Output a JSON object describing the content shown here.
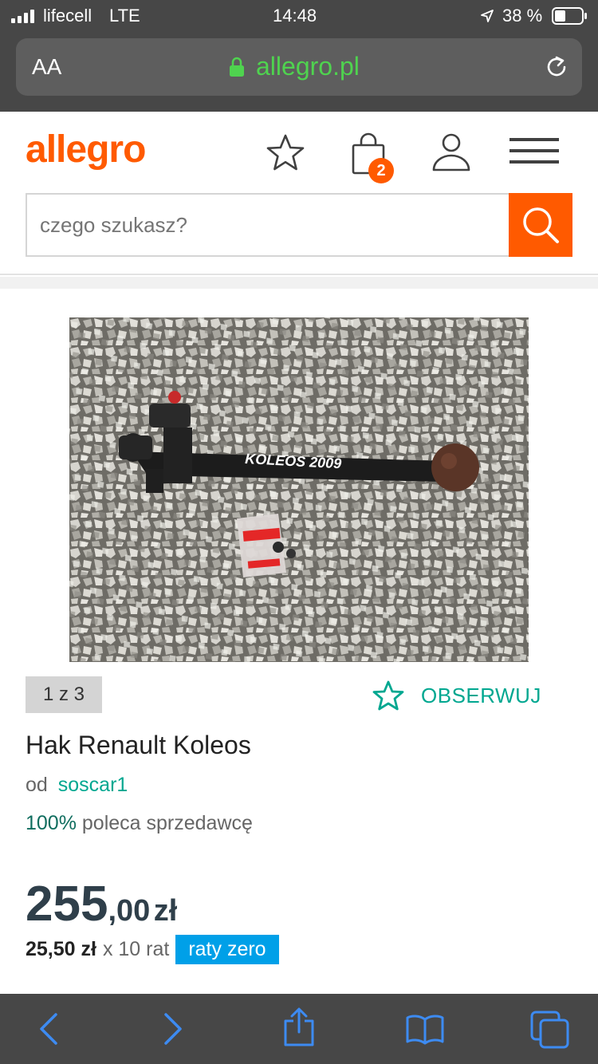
{
  "status_bar": {
    "carrier": "lifecell",
    "network": "LTE",
    "time": "14:48",
    "battery": "38 %"
  },
  "browser": {
    "text_size_label": "AA",
    "url": "allegro.pl"
  },
  "header": {
    "logo": "allegro",
    "cart_count": "2",
    "search_placeholder": "czego szukasz?"
  },
  "gallery": {
    "image_caption": "KOLEOS 2009",
    "counter": "1 z 3",
    "watch_label": "OBSERWUJ"
  },
  "product": {
    "title": "Hak Renault Koleos",
    "seller_prefix": "od",
    "seller": "soscar1",
    "recommend_percent": "100%",
    "recommend_text": "poleca sprzedawcę",
    "price_main": "255",
    "price_decimal": ",00",
    "currency": "zł",
    "installment_amount": "25,50 zł",
    "installment_count": "x 10 rat",
    "installment_badge": "raty zero"
  },
  "colors": {
    "brand_orange": "#ff5a00",
    "teal": "#00a790",
    "badge_blue": "#00a0e8",
    "ios_blue": "#3d8bf2",
    "price_dark": "#2f3f4a"
  },
  "icons": [
    "signal-icon",
    "location-arrow-icon",
    "battery-icon",
    "lock-icon",
    "reload-icon",
    "star-icon",
    "bag-icon",
    "user-icon",
    "menu-icon",
    "search-icon",
    "back-icon",
    "forward-icon",
    "share-icon",
    "bookmarks-icon",
    "tabs-icon"
  ]
}
